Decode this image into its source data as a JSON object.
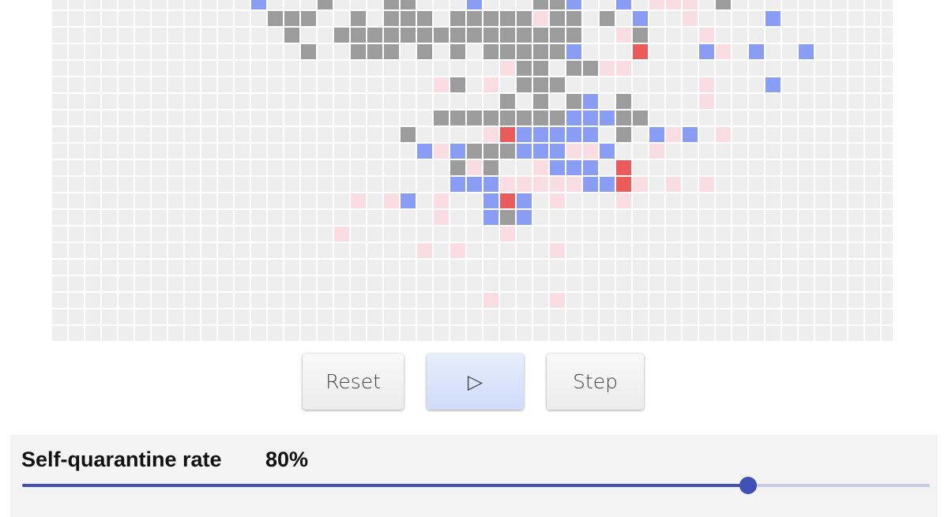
{
  "colors": {
    "empty": "#eeeeef",
    "gray": "#9c9c9c",
    "blue": "#8a9df5",
    "pink": "#fadde3",
    "red": "#ec5b5b"
  },
  "grid": {
    "cols": 51,
    "rows": 21,
    "cells": [
      [
        12,
        0,
        "blue"
      ],
      [
        16,
        0,
        "gray"
      ],
      [
        20,
        0,
        "gray"
      ],
      [
        21,
        0,
        "gray"
      ],
      [
        25,
        0,
        "blue"
      ],
      [
        29,
        0,
        "gray"
      ],
      [
        30,
        0,
        "gray"
      ],
      [
        31,
        0,
        "blue"
      ],
      [
        34,
        0,
        "blue"
      ],
      [
        36,
        0,
        "pink"
      ],
      [
        37,
        0,
        "pink"
      ],
      [
        38,
        0,
        "pink"
      ],
      [
        40,
        0,
        "gray"
      ],
      [
        13,
        1,
        "gray"
      ],
      [
        14,
        1,
        "gray"
      ],
      [
        15,
        1,
        "gray"
      ],
      [
        18,
        1,
        "gray"
      ],
      [
        20,
        1,
        "gray"
      ],
      [
        21,
        1,
        "gray"
      ],
      [
        22,
        1,
        "gray"
      ],
      [
        24,
        1,
        "gray"
      ],
      [
        25,
        1,
        "gray"
      ],
      [
        26,
        1,
        "gray"
      ],
      [
        27,
        1,
        "gray"
      ],
      [
        28,
        1,
        "gray"
      ],
      [
        29,
        1,
        "pink"
      ],
      [
        30,
        1,
        "gray"
      ],
      [
        31,
        1,
        "gray"
      ],
      [
        33,
        1,
        "gray"
      ],
      [
        35,
        1,
        "blue"
      ],
      [
        38,
        1,
        "pink"
      ],
      [
        43,
        1,
        "blue"
      ],
      [
        14,
        2,
        "gray"
      ],
      [
        17,
        2,
        "gray"
      ],
      [
        18,
        2,
        "gray"
      ],
      [
        19,
        2,
        "gray"
      ],
      [
        20,
        2,
        "gray"
      ],
      [
        21,
        2,
        "gray"
      ],
      [
        22,
        2,
        "gray"
      ],
      [
        23,
        2,
        "gray"
      ],
      [
        24,
        2,
        "gray"
      ],
      [
        25,
        2,
        "gray"
      ],
      [
        26,
        2,
        "gray"
      ],
      [
        27,
        2,
        "gray"
      ],
      [
        28,
        2,
        "gray"
      ],
      [
        29,
        2,
        "gray"
      ],
      [
        30,
        2,
        "gray"
      ],
      [
        31,
        2,
        "gray"
      ],
      [
        34,
        2,
        "pink"
      ],
      [
        35,
        2,
        "gray"
      ],
      [
        39,
        2,
        "pink"
      ],
      [
        15,
        3,
        "gray"
      ],
      [
        18,
        3,
        "gray"
      ],
      [
        19,
        3,
        "gray"
      ],
      [
        20,
        3,
        "gray"
      ],
      [
        22,
        3,
        "gray"
      ],
      [
        24,
        3,
        "gray"
      ],
      [
        26,
        3,
        "gray"
      ],
      [
        27,
        3,
        "gray"
      ],
      [
        28,
        3,
        "gray"
      ],
      [
        29,
        3,
        "gray"
      ],
      [
        30,
        3,
        "gray"
      ],
      [
        31,
        3,
        "blue"
      ],
      [
        35,
        3,
        "red"
      ],
      [
        39,
        3,
        "blue"
      ],
      [
        40,
        3,
        "pink"
      ],
      [
        42,
        3,
        "blue"
      ],
      [
        45,
        3,
        "blue"
      ],
      [
        27,
        4,
        "pink"
      ],
      [
        28,
        4,
        "gray"
      ],
      [
        29,
        4,
        "gray"
      ],
      [
        31,
        4,
        "gray"
      ],
      [
        32,
        4,
        "gray"
      ],
      [
        33,
        4,
        "pink"
      ],
      [
        34,
        4,
        "pink"
      ],
      [
        23,
        5,
        "pink"
      ],
      [
        24,
        5,
        "gray"
      ],
      [
        26,
        5,
        "pink"
      ],
      [
        28,
        5,
        "gray"
      ],
      [
        29,
        5,
        "gray"
      ],
      [
        30,
        5,
        "gray"
      ],
      [
        39,
        5,
        "pink"
      ],
      [
        43,
        5,
        "blue"
      ],
      [
        27,
        6,
        "gray"
      ],
      [
        29,
        6,
        "gray"
      ],
      [
        31,
        6,
        "gray"
      ],
      [
        32,
        6,
        "blue"
      ],
      [
        34,
        6,
        "gray"
      ],
      [
        39,
        6,
        "pink"
      ],
      [
        23,
        7,
        "gray"
      ],
      [
        24,
        7,
        "gray"
      ],
      [
        25,
        7,
        "gray"
      ],
      [
        26,
        7,
        "gray"
      ],
      [
        27,
        7,
        "gray"
      ],
      [
        28,
        7,
        "gray"
      ],
      [
        29,
        7,
        "gray"
      ],
      [
        30,
        7,
        "gray"
      ],
      [
        31,
        7,
        "blue"
      ],
      [
        32,
        7,
        "blue"
      ],
      [
        33,
        7,
        "blue"
      ],
      [
        34,
        7,
        "gray"
      ],
      [
        35,
        7,
        "gray"
      ],
      [
        21,
        8,
        "gray"
      ],
      [
        26,
        8,
        "pink"
      ],
      [
        27,
        8,
        "red"
      ],
      [
        28,
        8,
        "blue"
      ],
      [
        29,
        8,
        "blue"
      ],
      [
        30,
        8,
        "blue"
      ],
      [
        31,
        8,
        "blue"
      ],
      [
        32,
        8,
        "blue"
      ],
      [
        34,
        8,
        "gray"
      ],
      [
        36,
        8,
        "blue"
      ],
      [
        37,
        8,
        "pink"
      ],
      [
        38,
        8,
        "blue"
      ],
      [
        40,
        8,
        "pink"
      ],
      [
        22,
        9,
        "blue"
      ],
      [
        23,
        9,
        "pink"
      ],
      [
        24,
        9,
        "blue"
      ],
      [
        25,
        9,
        "gray"
      ],
      [
        26,
        9,
        "gray"
      ],
      [
        27,
        9,
        "gray"
      ],
      [
        28,
        9,
        "blue"
      ],
      [
        29,
        9,
        "blue"
      ],
      [
        30,
        9,
        "blue"
      ],
      [
        31,
        9,
        "pink"
      ],
      [
        32,
        9,
        "pink"
      ],
      [
        33,
        9,
        "blue"
      ],
      [
        36,
        9,
        "pink"
      ],
      [
        24,
        10,
        "gray"
      ],
      [
        25,
        10,
        "pink"
      ],
      [
        26,
        10,
        "gray"
      ],
      [
        29,
        10,
        "pink"
      ],
      [
        30,
        10,
        "blue"
      ],
      [
        31,
        10,
        "blue"
      ],
      [
        32,
        10,
        "blue"
      ],
      [
        34,
        10,
        "red"
      ],
      [
        24,
        11,
        "blue"
      ],
      [
        25,
        11,
        "blue"
      ],
      [
        26,
        11,
        "blue"
      ],
      [
        27,
        11,
        "pink"
      ],
      [
        28,
        11,
        "pink"
      ],
      [
        29,
        11,
        "pink"
      ],
      [
        30,
        11,
        "pink"
      ],
      [
        31,
        11,
        "pink"
      ],
      [
        32,
        11,
        "blue"
      ],
      [
        33,
        11,
        "blue"
      ],
      [
        34,
        11,
        "red"
      ],
      [
        35,
        11,
        "pink"
      ],
      [
        37,
        11,
        "pink"
      ],
      [
        39,
        11,
        "pink"
      ],
      [
        18,
        12,
        "pink"
      ],
      [
        20,
        12,
        "pink"
      ],
      [
        21,
        12,
        "blue"
      ],
      [
        23,
        12,
        "pink"
      ],
      [
        26,
        12,
        "blue"
      ],
      [
        27,
        12,
        "red"
      ],
      [
        28,
        12,
        "blue"
      ],
      [
        30,
        12,
        "pink"
      ],
      [
        34,
        12,
        "pink"
      ],
      [
        23,
        13,
        "pink"
      ],
      [
        26,
        13,
        "blue"
      ],
      [
        27,
        13,
        "gray"
      ],
      [
        28,
        13,
        "blue"
      ],
      [
        17,
        14,
        "pink"
      ],
      [
        27,
        14,
        "pink"
      ],
      [
        22,
        15,
        "pink"
      ],
      [
        24,
        15,
        "pink"
      ],
      [
        30,
        15,
        "pink"
      ],
      [
        26,
        18,
        "pink"
      ],
      [
        30,
        18,
        "pink"
      ]
    ]
  },
  "controls": {
    "reset_label": "Reset",
    "play_symbol": "▷",
    "step_label": "Step"
  },
  "quarantine": {
    "label": "Self-quarantine rate",
    "value_text": "80%",
    "value": 0.8
  }
}
